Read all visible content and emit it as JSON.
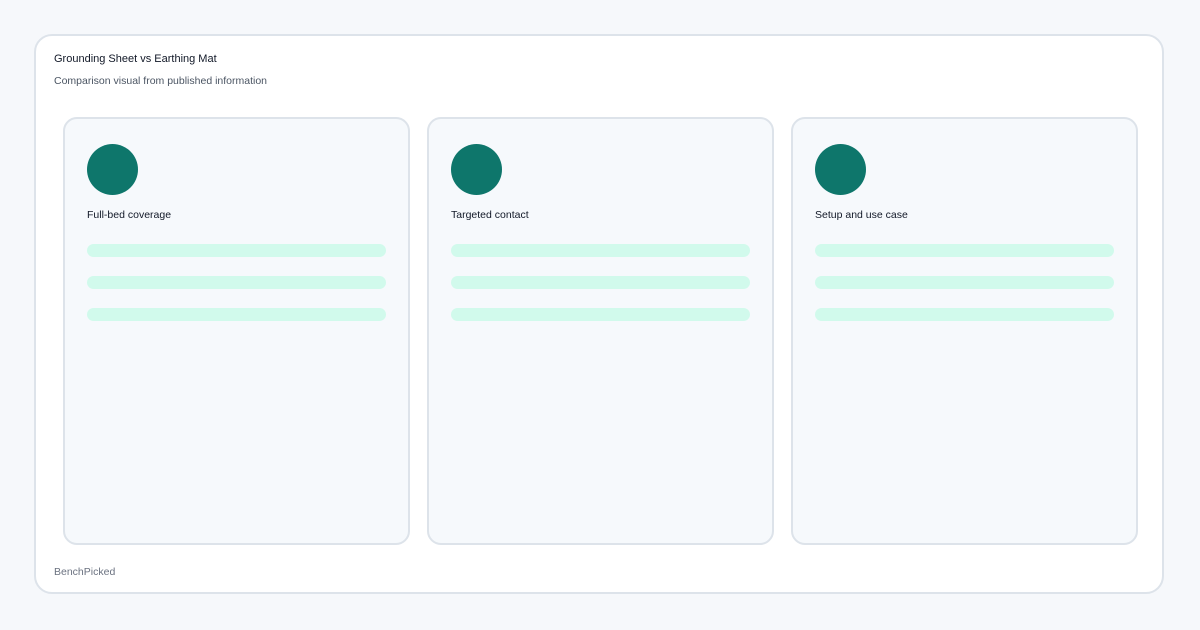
{
  "header": {
    "title": "Grounding Sheet vs Earthing Mat",
    "subtitle": "Comparison visual from published information"
  },
  "cards": [
    {
      "label": "Full-bed coverage",
      "icon": "filled-circle-icon"
    },
    {
      "label": "Targeted contact",
      "icon": "filled-circle-icon"
    },
    {
      "label": "Setup and use case",
      "icon": "filled-circle-icon"
    }
  ],
  "footer": {
    "brand": "BenchPicked"
  },
  "colors": {
    "accent": "#0e766b",
    "bar": "#d1faec",
    "page_background": "#f6f8fb",
    "card_background": "#f6f9fc",
    "border": "#dde3ea"
  }
}
